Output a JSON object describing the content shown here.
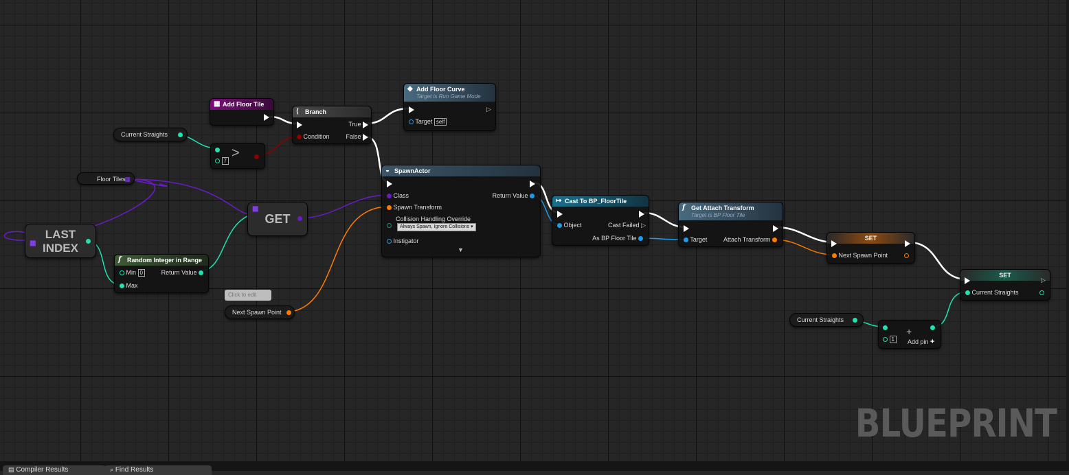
{
  "colors": {
    "exec": "#ffffff",
    "int": "#1ee3b0",
    "bool": "#8c0000",
    "object": "#6a1bc9",
    "struct_transform": "#ff7b00",
    "object_ref": "#1e9be8",
    "event_header": "#7a0f7a",
    "function_header": "#5b7f9a",
    "cast_header": "#1b5f7b",
    "pure_header": "#2d4a2a"
  },
  "nodes": {
    "add_floor_tile": {
      "title": "Add Floor Tile",
      "icon": "event-icon"
    },
    "branch": {
      "title": "Branch",
      "true_label": "True",
      "false_label": "False",
      "condition_label": "Condition"
    },
    "add_floor_curve": {
      "title": "Add Floor Curve",
      "subtitle": "Target is Run Game Mode",
      "target_label": "Target",
      "target_value": "self"
    },
    "compare": {
      "op": ">",
      "value": "7"
    },
    "floor_tiles": {
      "label": "Floor Tiles"
    },
    "current_straights_get_1": {
      "label": "Current Straights"
    },
    "last_index": {
      "line1": "LAST",
      "line2": "INDEX"
    },
    "get": {
      "label": "GET"
    },
    "random_int": {
      "title": "Random Integer in Range",
      "min_label": "Min",
      "min_value": "0",
      "max_label": "Max",
      "return_label": "Return Value"
    },
    "comment": {
      "label": "Click to edit"
    },
    "next_spawn_point_get": {
      "label": "Next Spawn Point"
    },
    "spawn_actor": {
      "title": "SpawnActor",
      "class_label": "Class",
      "return_label": "Return Value",
      "transform_label": "Spawn Transform",
      "collision_label": "Collision Handling Override",
      "collision_value": "Always Spawn, Ignore Collisions",
      "instigator_label": "Instigator"
    },
    "cast": {
      "title": "Cast To BP_FloorTile",
      "object_label": "Object",
      "cast_failed_label": "Cast Failed",
      "as_label": "As BP Floor Tile"
    },
    "get_attach_transform": {
      "title": "Get Attach Transform",
      "subtitle": "Target is BP Floor Tile",
      "target_label": "Target",
      "return_label": "Attach Transform"
    },
    "set_spawn": {
      "title": "SET",
      "pin_label": "Next Spawn Point"
    },
    "set_straights": {
      "title": "SET",
      "pin_label": "Current Straights"
    },
    "current_straights_get_2": {
      "label": "Current Straights"
    },
    "add": {
      "value": "1",
      "add_pin_label": "Add pin"
    }
  },
  "watermark": "BLUEPRINT",
  "tabs": [
    {
      "label": "Compiler Results"
    },
    {
      "label": "Find Results"
    }
  ]
}
